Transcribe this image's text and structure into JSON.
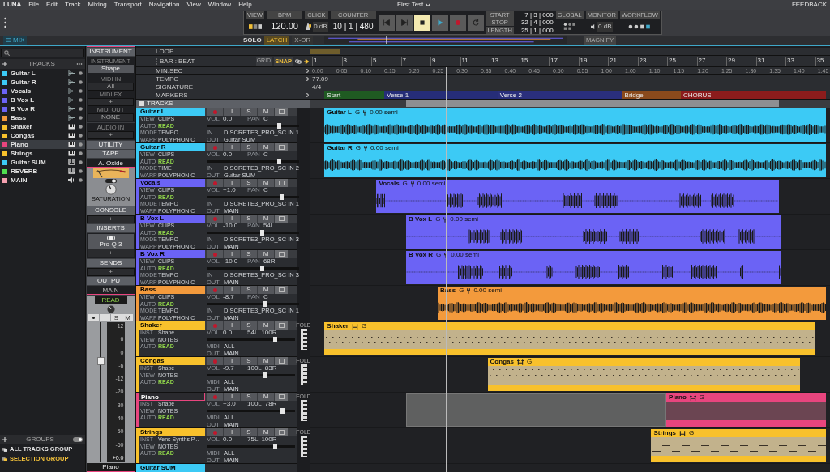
{
  "menu_bar": {
    "items": [
      "LUNA",
      "File",
      "Edit",
      "Track",
      "Mixing",
      "Transport",
      "Navigation",
      "View",
      "Window",
      "Help"
    ],
    "project_title": "First Test",
    "feedback": "FEEDBACK"
  },
  "transport": {
    "view_label": "VIEW",
    "bpm_label": "BPM",
    "bpm": "120.00",
    "click_label": "CLICK",
    "click_level": "0 dB",
    "counter_label": "COUNTER",
    "counter": "10 | 1 | 480",
    "buttons": [
      {
        "kind": "rewind",
        "selected": false
      },
      {
        "kind": "forward",
        "selected": false
      },
      {
        "kind": "stop",
        "selected": true
      },
      {
        "kind": "play",
        "selected": false
      },
      {
        "kind": "record",
        "selected": false
      },
      {
        "kind": "loop",
        "selected": false
      }
    ],
    "range": [
      {
        "label": "START",
        "value": "7 | 3 | 000"
      },
      {
        "label": "STOP",
        "value": "32 | 4 | 000"
      },
      {
        "label": "LENGTH",
        "value": "25 | 1 | 000"
      }
    ],
    "global_label": "GLOBAL",
    "monitor_label": "MONITOR",
    "monitor_level": "0 dB",
    "workflow_label": "WORKFLOW"
  },
  "sub_bar": {
    "tab": "MIX",
    "solo_label": "SOLO",
    "solo_modes": [
      {
        "label": "LATCH",
        "selected": true
      },
      {
        "label": "X-OR",
        "selected": false
      }
    ],
    "magnify": "MAGNIFY"
  },
  "track_list": {
    "header": "TRACKS",
    "tracks": [
      {
        "name": "Guitar L",
        "color": "#3ccaf5",
        "kind": "audio",
        "selected": false
      },
      {
        "name": "Guitar R",
        "color": "#3ccaf5",
        "kind": "audio",
        "selected": false
      },
      {
        "name": "Vocals",
        "color": "#6b63f5",
        "kind": "audio",
        "selected": false
      },
      {
        "name": "B Vox L",
        "color": "#6b63f5",
        "kind": "audio",
        "selected": false
      },
      {
        "name": "B Vox R",
        "color": "#6b63f5",
        "kind": "audio",
        "selected": false
      },
      {
        "name": "Bass",
        "color": "#f39a3c",
        "kind": "audio",
        "selected": false
      },
      {
        "name": "Shaker",
        "color": "#f8c12c",
        "kind": "instrument",
        "selected": false
      },
      {
        "name": "Congas",
        "color": "#f8c12c",
        "kind": "instrument",
        "selected": false
      },
      {
        "name": "Piano",
        "color": "#e8457e",
        "kind": "instrument",
        "selected": true
      },
      {
        "name": "Strings",
        "color": "#f8c12c",
        "kind": "instrument",
        "selected": false
      },
      {
        "name": "Guitar SUM",
        "color": "#3ccaf5",
        "kind": "bus",
        "selected": false
      },
      {
        "name": "REVERB",
        "color": "#4fdc4f",
        "kind": "bus",
        "selected": false
      },
      {
        "name": "MAIN",
        "color": "#f4a0b0",
        "kind": "master",
        "selected": false
      }
    ],
    "groups_header": "GROUPS",
    "groups_on": true,
    "groups": [
      {
        "name": "ALL TRACKS GROUP",
        "selected": false
      },
      {
        "name": "SELECTION GROUP",
        "selected": true
      }
    ]
  },
  "inspector": {
    "instrument_header": "INSTRUMENT",
    "instrument_label": "INSTRUMENT",
    "instrument": "Shape",
    "midi": [
      {
        "label": "MIDI IN",
        "value": "All"
      },
      {
        "label": "MIDI FX",
        "value": "+"
      },
      {
        "label": "MIDI OUT",
        "value": "NONE"
      }
    ],
    "audio_in": {
      "label": "AUDIO IN",
      "value": "+"
    },
    "utility": "UTILITY",
    "tape_header": "TAPE",
    "tape_preset": "A. Oxide",
    "tape_knob": "SATURATION",
    "console_header": "CONSOLE",
    "console_add": "+",
    "inserts_header": "INSERTS",
    "inserts": [
      "Pro-Q 3"
    ],
    "inserts_add": "+",
    "sends_header": "SENDS",
    "sends_add": "+",
    "output_header": "OUTPUT",
    "output": "MAIN",
    "strip": {
      "automation": "READ",
      "buttons": [
        "I",
        "S",
        "M"
      ],
      "level": 0.72,
      "scale": [
        "12",
        "6",
        "0",
        "-6",
        "-12",
        "-20",
        "-30",
        "-40",
        "-50",
        "-60"
      ],
      "readout": "+0.0",
      "name": "Piano"
    }
  },
  "ruler": {
    "rows": [
      "LOOP",
      "BAR : BEAT",
      "MIN:SEC",
      "TEMPO",
      "SIGNATURE",
      "MARKERS"
    ],
    "grid_label": "GRID",
    "snap_label": "SNAP",
    "snap_on": true,
    "tracks_label": "TRACKS",
    "bars": [
      "1",
      "3",
      "5",
      "7",
      "9",
      "11",
      "13",
      "15",
      "17",
      "19",
      "21",
      "23",
      "25",
      "27",
      "29",
      "31",
      "33",
      "35"
    ],
    "times": [
      "0:00",
      "0:05",
      "0:10",
      "0:15",
      "0:20",
      "0:25",
      "0:30",
      "0:35",
      "0:40",
      "0:45",
      "0:50",
      "0:55",
      "1:00",
      "1:05",
      "1:10",
      "1:15",
      "1:20",
      "1:25",
      "1:30",
      "1:35",
      "1:40",
      "1:45"
    ],
    "tempo": "77.09",
    "signature": "4/4",
    "markers": [
      {
        "name": "Start",
        "color": "#1f5a22"
      },
      {
        "name": "Verse 1",
        "color": "#262d78"
      },
      {
        "name": "Verse 2",
        "color": "#2a2f7c"
      },
      {
        "name": "Bridge",
        "color": "#8a4a1c"
      },
      {
        "name": "CHORUS",
        "color": "#8c1c1c"
      }
    ]
  },
  "tracks": [
    {
      "name": "Guitar L",
      "color": "#3ccaf5",
      "kind": "audio",
      "selected": false,
      "buttons": [
        "I",
        "S",
        "M"
      ],
      "left": [
        {
          "label": "VIEW",
          "value": "CLIPS"
        },
        {
          "label": "AUTO",
          "value": "READ"
        },
        {
          "label": "MODE",
          "value": "TEMPO"
        },
        {
          "label": "WARP",
          "value": "POLYPHONIC"
        }
      ],
      "vol_label": "VOL",
      "vol": "0.0",
      "pan_label": "PAN",
      "pan": "C",
      "level": 0.78,
      "routing": [
        {
          "label": "IN",
          "value": "DISCRETE3_PRO_SC IN 1"
        },
        {
          "label": "OUT",
          "value": "Guitar SUM"
        }
      ],
      "clip": {
        "name": "Guitar L",
        "tag": "G",
        "detail": "0.00 semi"
      }
    },
    {
      "name": "Guitar R",
      "color": "#3ccaf5",
      "kind": "audio",
      "selected": false,
      "buttons": [
        "I",
        "S",
        "M"
      ],
      "left": [
        {
          "label": "VIEW",
          "value": "CLIPS"
        },
        {
          "label": "AUTO",
          "value": "READ"
        },
        {
          "label": "MODE",
          "value": "TIME"
        },
        {
          "label": "WARP",
          "value": "POLYPHONIC"
        }
      ],
      "vol_label": "VOL",
      "vol": "0.0",
      "pan_label": "PAN",
      "pan": "C",
      "level": 0.78,
      "routing": [
        {
          "label": "IN",
          "value": "DISCRETE3_PRO_SC IN 2"
        },
        {
          "label": "OUT",
          "value": "Guitar SUM"
        }
      ],
      "clip": {
        "name": "Guitar R",
        "tag": "G",
        "detail": "0.00 semi"
      }
    },
    {
      "name": "Vocals",
      "color": "#6b63f5",
      "kind": "audio",
      "selected": false,
      "buttons": [
        "I",
        "S",
        "M"
      ],
      "left": [
        {
          "label": "VIEW",
          "value": "CLIPS"
        },
        {
          "label": "AUTO",
          "value": "READ"
        },
        {
          "label": "MODE",
          "value": "TEMPO"
        },
        {
          "label": "WARP",
          "value": "POLYPHONIC"
        }
      ],
      "vol_label": "VOL",
      "vol": "+1.0",
      "pan_label": "PAN",
      "pan": "C",
      "level": 0.81,
      "routing": [
        {
          "label": "IN",
          "value": "DISCRETE3_PRO_SC IN 1"
        },
        {
          "label": "OUT",
          "value": "MAIN"
        }
      ],
      "clip": {
        "name": "Vocals",
        "tag": "G",
        "detail": "0.00 semi"
      }
    },
    {
      "name": "B Vox L",
      "color": "#6b63f5",
      "kind": "audio",
      "selected": false,
      "buttons": [
        "I",
        "S",
        "M"
      ],
      "left": [
        {
          "label": "VIEW",
          "value": "CLIPS"
        },
        {
          "label": "AUTO",
          "value": "READ"
        },
        {
          "label": "MODE",
          "value": "TEMPO"
        },
        {
          "label": "WARP",
          "value": "POLYPHONIC"
        }
      ],
      "vol_label": "VOL",
      "vol": "-10.0",
      "pan_label": "PAN",
      "pan": "54L",
      "level": 0.6,
      "routing": [
        {
          "label": "IN",
          "value": "DISCRETE3_PRO_SC IN 3"
        },
        {
          "label": "OUT",
          "value": "MAIN"
        }
      ],
      "clip": {
        "name": "B Vox L",
        "tag": "G",
        "detail": "0.00 semi"
      }
    },
    {
      "name": "B Vox R",
      "color": "#6b63f5",
      "kind": "audio",
      "selected": false,
      "buttons": [
        "I",
        "S",
        "M"
      ],
      "left": [
        {
          "label": "VIEW",
          "value": "CLIPS"
        },
        {
          "label": "AUTO",
          "value": "READ"
        },
        {
          "label": "MODE",
          "value": "TEMPO"
        },
        {
          "label": "WARP",
          "value": "POLYPHONIC"
        }
      ],
      "vol_label": "VOL",
      "vol": "-10.0",
      "pan_label": "PAN",
      "pan": "68R",
      "level": 0.6,
      "routing": [
        {
          "label": "IN",
          "value": "DISCRETE3_PRO_SC IN 3"
        },
        {
          "label": "OUT",
          "value": "MAIN"
        }
      ],
      "clip": {
        "name": "B Vox R",
        "tag": "G",
        "detail": "0.00 semi"
      }
    },
    {
      "name": "Bass",
      "color": "#f39a3c",
      "kind": "audio",
      "selected": false,
      "buttons": [
        "I",
        "S",
        "M"
      ],
      "left": [
        {
          "label": "VIEW",
          "value": "CLIPS"
        },
        {
          "label": "AUTO",
          "value": "READ"
        },
        {
          "label": "MODE",
          "value": "TEMPO"
        },
        {
          "label": "WARP",
          "value": "POLYPHONIC"
        }
      ],
      "vol_label": "VOL",
      "vol": "-8.7",
      "pan_label": "PAN",
      "pan": "C",
      "level": 0.62,
      "routing": [
        {
          "label": "IN",
          "value": "DISCRETE3_PRO_SC IN 1"
        },
        {
          "label": "OUT",
          "value": "MAIN"
        }
      ],
      "clip": {
        "name": "Bass",
        "tag": "G",
        "detail": "0.00 semi"
      }
    },
    {
      "name": "Shaker",
      "color": "#f8c12c",
      "kind": "instrument",
      "selected": false,
      "buttons": [
        "I",
        "S",
        "M"
      ],
      "left": [
        {
          "label": "INST",
          "value": "Shape"
        },
        {
          "label": "VIEW",
          "value": "NOTES"
        },
        {
          "label": "AUTO",
          "value": "READ"
        }
      ],
      "vol_label": "VOL",
      "vol": "0.0",
      "pan_l": "54L",
      "pan_r": "100R",
      "level": 0.77,
      "routing": [
        {
          "label": "MIDI",
          "value": "ALL"
        },
        {
          "label": "OUT",
          "value": "MAIN"
        }
      ],
      "fold": "FOLD",
      "clip": {
        "name": "Shaker",
        "tag": "G"
      }
    },
    {
      "name": "Congas",
      "color": "#f8c12c",
      "kind": "instrument",
      "selected": false,
      "buttons": [
        "I",
        "S",
        "M"
      ],
      "left": [
        {
          "label": "INST",
          "value": "Shape"
        },
        {
          "label": "VIEW",
          "value": "NOTES"
        },
        {
          "label": "AUTO",
          "value": "READ"
        }
      ],
      "vol_label": "VOL",
      "vol": "-9.7",
      "pan_l": "100L",
      "pan_r": "83R",
      "level": 0.65,
      "routing": [
        {
          "label": "MIDI",
          "value": "ALL"
        },
        {
          "label": "OUT",
          "value": "MAIN"
        }
      ],
      "fold": "FOLD",
      "clip": {
        "name": "Congas",
        "tag": "G"
      }
    },
    {
      "name": "Piano",
      "color": "#e8457e",
      "kind": "instrument",
      "selected": true,
      "buttons": [
        "I",
        "S",
        "M"
      ],
      "left": [
        {
          "label": "INST",
          "value": "Shape"
        },
        {
          "label": "VIEW",
          "value": "NOTES"
        },
        {
          "label": "AUTO",
          "value": "READ"
        }
      ],
      "vol_label": "VOL",
      "vol": "+3.0",
      "pan_l": "100L",
      "pan_r": "78R",
      "level": 0.85,
      "routing": [
        {
          "label": "MIDI",
          "value": "ALL"
        },
        {
          "label": "OUT",
          "value": "MAIN"
        }
      ],
      "fold": "FOLD",
      "clip": {
        "name": "Piano",
        "tag": "G"
      }
    },
    {
      "name": "Strings",
      "color": "#f8c12c",
      "kind": "instrument",
      "selected": false,
      "buttons": [
        "I",
        "S",
        "M"
      ],
      "left": [
        {
          "label": "INST",
          "value": "Vens Synths P..."
        },
        {
          "label": "VIEW",
          "value": "NOTES"
        },
        {
          "label": "AUTO",
          "value": "READ"
        }
      ],
      "vol_label": "VOL",
      "vol": "0.0",
      "pan_l": "75L",
      "pan_r": "100R",
      "level": 0.77,
      "routing": [
        {
          "label": "MIDI",
          "value": "ALL"
        },
        {
          "label": "OUT",
          "value": "MAIN"
        }
      ],
      "fold": "FOLD",
      "clip": {
        "name": "Strings",
        "tag": "G"
      }
    },
    {
      "name": "Guitar SUM",
      "color": "#3ccaf5",
      "kind": "bus",
      "selected": false
    }
  ]
}
